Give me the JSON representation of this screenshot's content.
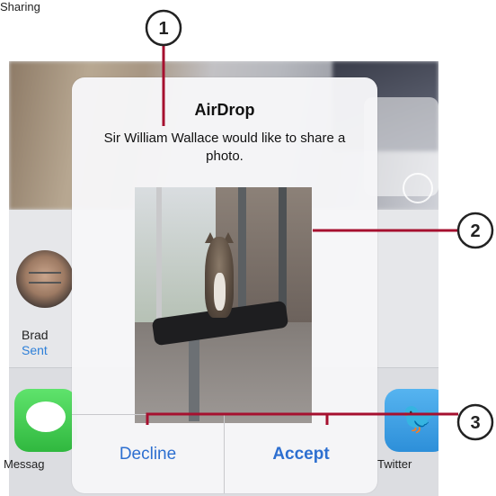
{
  "dialog": {
    "title": "AirDrop",
    "message": "Sir William Wallace would like to share a photo.",
    "decline_label": "Decline",
    "accept_label": "Accept"
  },
  "background": {
    "contact": {
      "name": "Brad",
      "status": "Sent"
    },
    "apps": [
      {
        "label": "Messag",
        "icon": "messages-icon"
      },
      {
        "label": "Twitter",
        "icon": "twitter-icon"
      }
    ],
    "sharing_label": "Sharing"
  },
  "callouts": [
    "1",
    "2",
    "3"
  ],
  "colors": {
    "accent_blue": "#2d6fd0",
    "callout_line": "#a6102f",
    "messages_green": "#30b83f",
    "twitter_blue": "#2d8fd9"
  }
}
